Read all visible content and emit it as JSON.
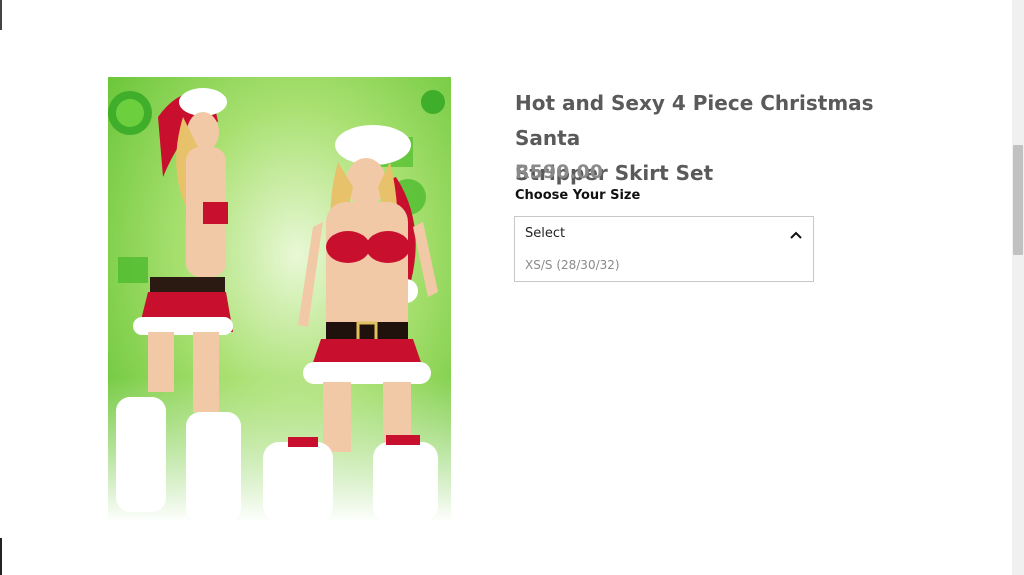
{
  "product": {
    "title_line1": "Hot and Sexy 4 Piece Christmas Santa",
    "title_line2": "Stripper Skirt Set",
    "price": "R590.00",
    "image_alt": "Product photo"
  },
  "size_selector": {
    "label": "Choose Your Size",
    "selected": "Select",
    "options": [
      "XS/S (28/30/32)"
    ]
  },
  "colors": {
    "title": "#5a5a5a",
    "price": "#8a8a8a",
    "image_bg_green": "#7fd24a",
    "santa_red": "#c8102e"
  },
  "icons": {
    "dropdown": "chevron-up-icon"
  }
}
